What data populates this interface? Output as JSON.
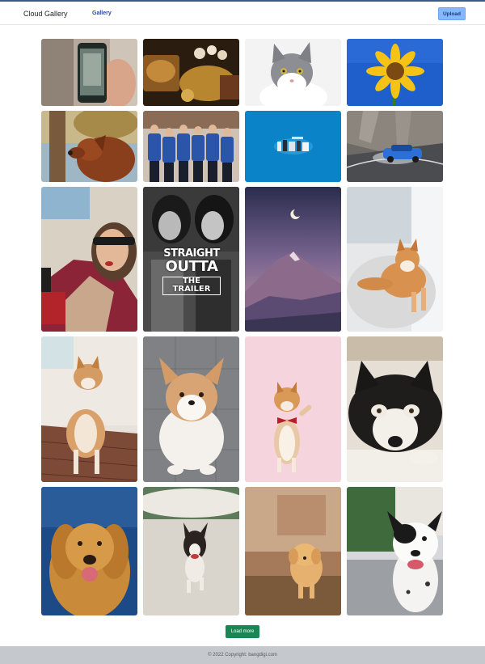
{
  "header": {
    "brand": "Cloud Gallery",
    "nav_gallery": "Gallery",
    "upload_label": "Upload"
  },
  "gallery": {
    "load_more_label": "Load more",
    "photos": [
      {
        "subject": "hand holding phone photo",
        "overlay_lines": []
      },
      {
        "subject": "gold jewelry treasure",
        "overlay_lines": []
      },
      {
        "subject": "grey and white cat",
        "overlay_lines": []
      },
      {
        "subject": "sunflower on blue sky",
        "overlay_lines": []
      },
      {
        "subject": "brown dog under trees",
        "overlay_lines": []
      },
      {
        "subject": "team in blue jackets",
        "overlay_lines": []
      },
      {
        "subject": "blue product banner",
        "overlay_lines": []
      },
      {
        "subject": "blue car on mountain road",
        "overlay_lines": []
      },
      {
        "subject": "woman in sunglasses",
        "overlay_lines": []
      },
      {
        "subject": "movie poster",
        "overlay_lines": [
          "STRAIGHT",
          "OUTTA",
          "THE TRAILER"
        ]
      },
      {
        "subject": "mountain at dusk with moon",
        "overlay_lines": []
      },
      {
        "subject": "shiba inu on rug",
        "overlay_lines": []
      },
      {
        "subject": "shiba inu on bench",
        "overlay_lines": []
      },
      {
        "subject": "corgi puppy",
        "overlay_lines": []
      },
      {
        "subject": "shiba with bow tie on pink",
        "overlay_lines": []
      },
      {
        "subject": "husky puppy",
        "overlay_lines": []
      },
      {
        "subject": "golden retriever",
        "overlay_lines": []
      },
      {
        "subject": "running puppy on snow",
        "overlay_lines": []
      },
      {
        "subject": "golden puppy in field",
        "overlay_lines": []
      },
      {
        "subject": "black and white dog",
        "overlay_lines": []
      }
    ]
  },
  "footer": {
    "copyright": "© 2022 Copyright: bangdigi.com"
  }
}
